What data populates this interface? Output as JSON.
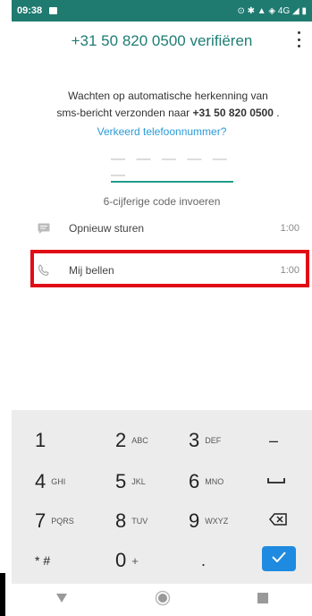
{
  "status": {
    "time": "09:38",
    "right": "⊙ ✱ ▲ ◈ 4G ◢ ▮"
  },
  "header": {
    "title": "+31 50 820 0500 verifiëren"
  },
  "desc": {
    "line1": "Wachten op automatische herkenning van",
    "line2_prefix": "sms-bericht verzonden naar ",
    "line2_phone": "+31 50 820 0500",
    "line2_suffix": " .",
    "wrong_number": "Verkeerd telefoonnummer?"
  },
  "code": {
    "placeholder": "— — —   — — —",
    "hint": "6-cijferige code invoeren"
  },
  "actions": {
    "resend": {
      "label": "Opnieuw sturen",
      "timer": "1:00"
    },
    "call": {
      "label": "Mij bellen",
      "timer": "1:00"
    }
  },
  "keypad": {
    "k1": {
      "num": "1",
      "letters": ""
    },
    "k2": {
      "num": "2",
      "letters": "ABC"
    },
    "k3": {
      "num": "3",
      "letters": "DEF"
    },
    "k4": {
      "num": "4",
      "letters": "GHI"
    },
    "k5": {
      "num": "5",
      "letters": "JKL"
    },
    "k6": {
      "num": "6",
      "letters": "MNO"
    },
    "k7": {
      "num": "7",
      "letters": "PQRS"
    },
    "k8": {
      "num": "8",
      "letters": "TUV"
    },
    "k9": {
      "num": "9",
      "letters": "WXYZ"
    },
    "k0": {
      "num": "0",
      "letters": "+"
    },
    "star": "* #",
    "minus": "–",
    "dot": "."
  },
  "colors": {
    "accent": "#1e7d74",
    "link": "#2a9bd8",
    "highlight": "#e10d16",
    "ok": "#1e8be0"
  },
  "icons": {
    "resend": "message-icon",
    "call": "phone-icon",
    "menu": "more-vert-icon",
    "backspace": "backspace-icon",
    "ok": "check-icon",
    "space": "space-icon"
  }
}
